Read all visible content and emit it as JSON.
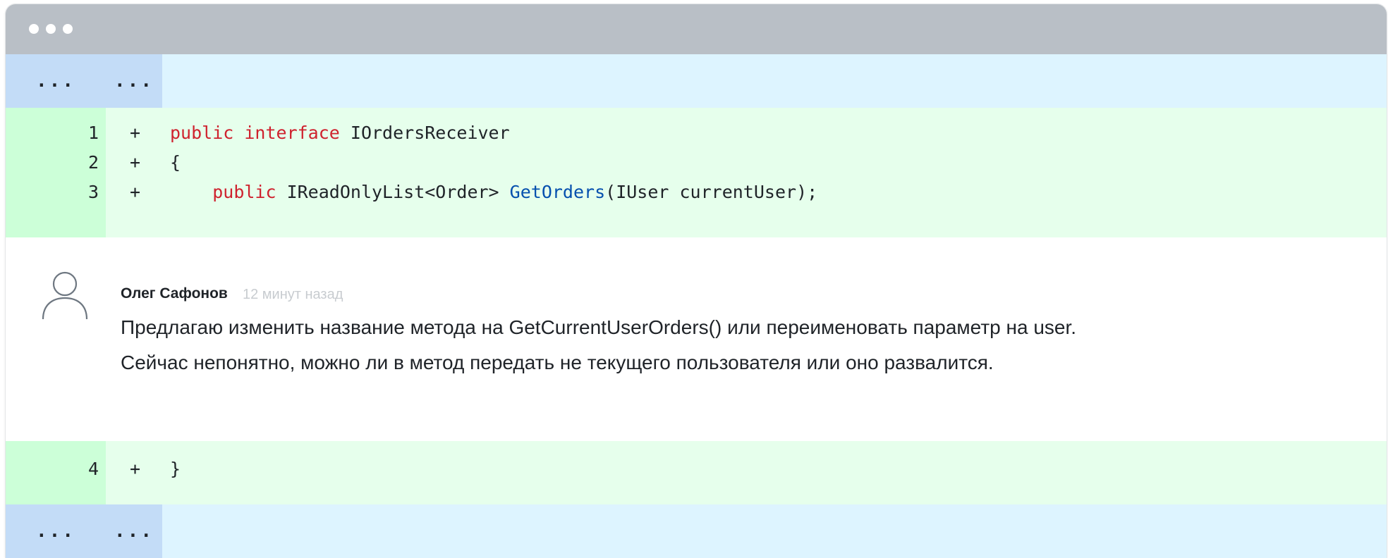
{
  "window": {
    "controls": [
      "dot",
      "dot",
      "dot"
    ]
  },
  "hunk_header": {
    "old_marker": "...",
    "new_marker": "..."
  },
  "diff": {
    "lines": [
      {
        "number": "1",
        "sign": "+",
        "indent": "",
        "tokens": [
          {
            "text": "public",
            "kind": "keyword"
          },
          {
            "text": " ",
            "kind": "plain"
          },
          {
            "text": "interface",
            "kind": "keyword"
          },
          {
            "text": " IOrdersReceiver",
            "kind": "plain"
          }
        ]
      },
      {
        "number": "2",
        "sign": "+",
        "indent": "",
        "tokens": [
          {
            "text": "{",
            "kind": "plain"
          }
        ]
      },
      {
        "number": "3",
        "sign": "+",
        "indent": "    ",
        "tokens": [
          {
            "text": "public",
            "kind": "keyword"
          },
          {
            "text": " IReadOnlyList<Order> ",
            "kind": "plain"
          },
          {
            "text": "GetOrders",
            "kind": "function"
          },
          {
            "text": "(IUser currentUser);",
            "kind": "plain"
          }
        ]
      },
      {
        "number": "4",
        "sign": "+",
        "indent": "",
        "tokens": [
          {
            "text": "}",
            "kind": "plain"
          }
        ]
      }
    ]
  },
  "comment": {
    "avatar_icon": "user-avatar-icon",
    "author": "Олег Сафонов",
    "time": "12 минут назад",
    "body": [
      "Предлагаю изменить название метода на GetCurrentUserOrders() или переименовать параметр на user.",
      "Сейчас непонятно, можно ли в метод передать не текущего пользователя или оно развалится."
    ]
  },
  "colors": {
    "titlebar": "#b9bfc6",
    "hunk_bg": "#ddf4ff",
    "hunk_gutter": "#c3dcf7",
    "added_bg": "#e6ffec",
    "added_gutter": "#ccffd8",
    "keyword": "#cf222e",
    "function": "#0550ae",
    "muted_text": "#c8ccd0"
  }
}
